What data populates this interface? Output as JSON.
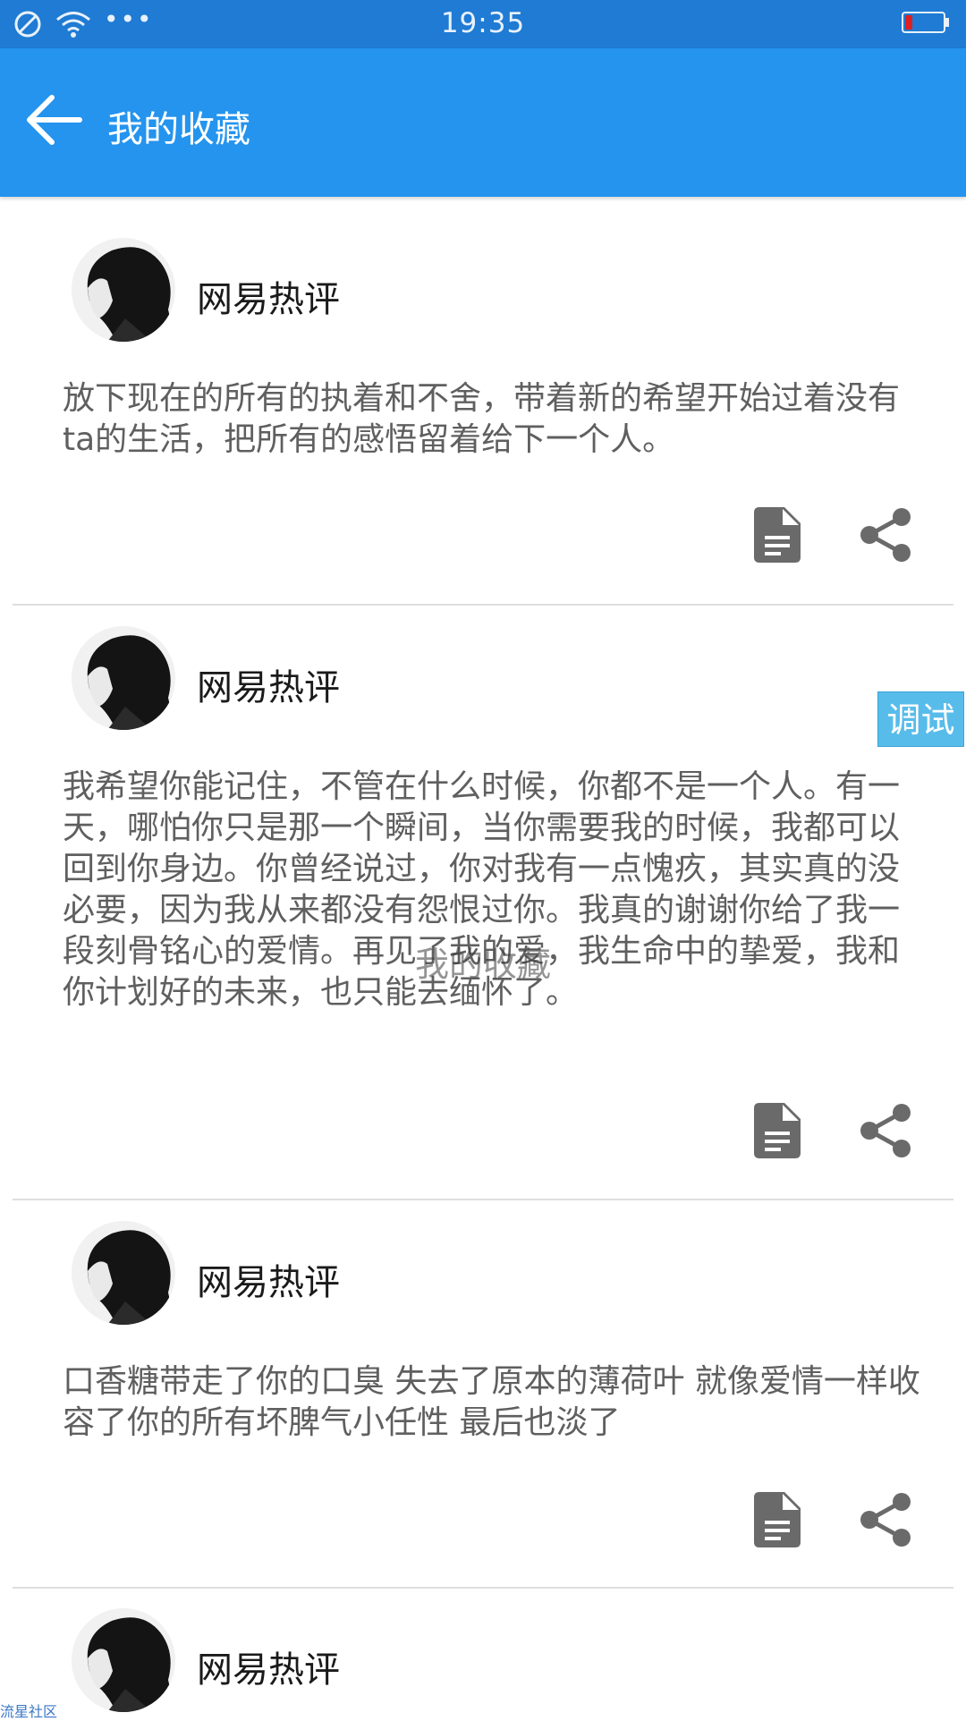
{
  "status_bar": {
    "time": "19:35",
    "icons": [
      "no-disturb-icon",
      "wifi-icon",
      "more-dots-icon",
      "battery-low-icon"
    ],
    "dots": "•••",
    "battery_color": "#e02020"
  },
  "app_bar": {
    "title": "我的收藏",
    "background": "#2494ee",
    "back_icon": "arrow-left-icon"
  },
  "favorites": [
    {
      "name": "网易热评",
      "text": "放下现在的所有的执着和不舍，带着新的希望开始过着没有ta的生活，把所有的感悟留着给下一个人。"
    },
    {
      "name": "网易热评",
      "text": "我希望你能记住，不管在什么时候，你都不是一个人。有一天，哪怕你只是那一个瞬间，当你需要我的时候，我都可以回到你身边。你曾经说过，你对我有一点愧疚，其实真的没必要，因为我从来都没有怨恨过你。我真的谢谢你给了我一段刻骨铭心的爱情。再见了我的爱，我生命中的挚爱，我和你计划好的未来，也只能去缅怀了。"
    },
    {
      "name": "网易热评",
      "text": "口香糖带走了你的口臭 失去了原本的薄荷叶 就像爱情一样收容了你的所有坏脾气小任性 最后也淡了"
    },
    {
      "name": "网易热评",
      "text": ""
    }
  ],
  "card_actions": [
    "document-icon",
    "share-icon"
  ],
  "debug_badge": "调试",
  "watermark": "我的收藏",
  "corner_tag": "流星社区"
}
